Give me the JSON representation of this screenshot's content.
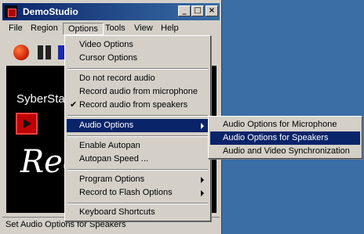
{
  "window": {
    "title": "DemoStudio",
    "buttons": {
      "minimize": "_",
      "maximize": "□",
      "close": "×"
    }
  },
  "menubar": {
    "items": [
      "File",
      "Region",
      "Options",
      "Tools",
      "View",
      "Help"
    ],
    "active": "Options"
  },
  "toolbar": {
    "record_icon": "record-icon",
    "pause_icon": "pause-icon",
    "stop_icon": "stop-icon"
  },
  "preview": {
    "brand": "SyberSta",
    "big_text": "Rec"
  },
  "options_menu": {
    "items": {
      "video_options": "Video Options",
      "cursor_options": "Cursor Options",
      "no_audio": "Do not record audio",
      "audio_mic": "Record audio from microphone",
      "audio_speakers": "Record audio from speakers",
      "audio_options": "Audio Options",
      "enable_autopan": "Enable Autopan",
      "autopan_speed": "Autopan Speed ...",
      "program_options": "Program Options",
      "record_flash": "Record to Flash Options",
      "keyboard_shortcuts": "Keyboard Shortcuts"
    },
    "checked": "Record audio from speakers",
    "highlighted": "Audio Options"
  },
  "audio_submenu": {
    "items": {
      "microphone": "Audio Options for Microphone",
      "speakers": "Audio Options for Speakers",
      "sync": "Audio and  Video Synchronization"
    },
    "highlighted": "Audio Options for Speakers"
  },
  "status": {
    "text": "Set Audio Options for Speakers"
  },
  "colors": {
    "desktop": "#3a6ea5",
    "titlebar": "#0a246a",
    "highlight": "#0a246a",
    "face": "#d4d0c8"
  }
}
